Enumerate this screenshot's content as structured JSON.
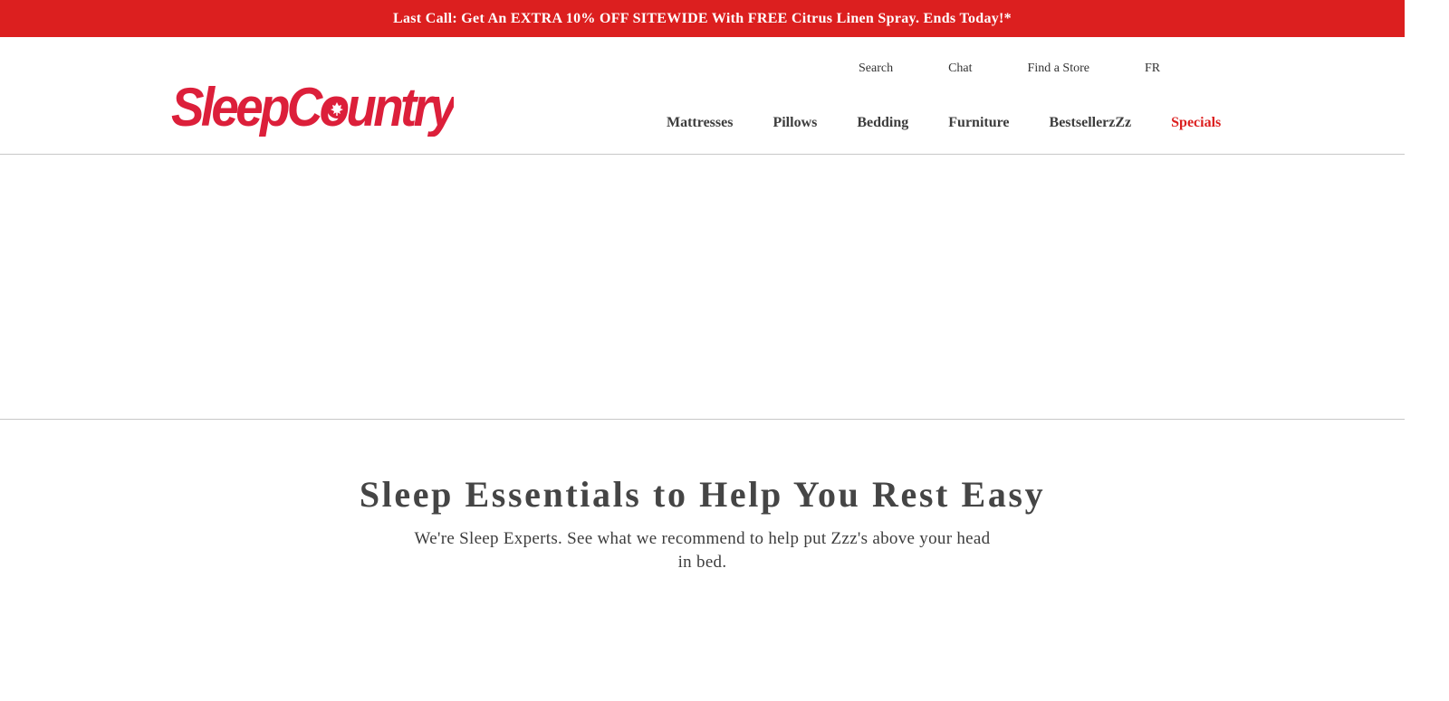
{
  "promo": {
    "text": "Last Call: Get An EXTRA 10% OFF SITEWIDE With FREE Citrus Linen Spray. Ends Today!*"
  },
  "brand": {
    "logo_text": "SleepCountry",
    "logo_icon": "maple-leaf-icon",
    "color": "#dc1f1f"
  },
  "utility_nav": {
    "items": [
      {
        "label": "Search"
      },
      {
        "label": "Chat"
      },
      {
        "label": "Find a Store"
      },
      {
        "label": "FR"
      }
    ]
  },
  "main_nav": {
    "items": [
      {
        "label": "Mattresses"
      },
      {
        "label": "Pillows"
      },
      {
        "label": "Bedding"
      },
      {
        "label": "Furniture"
      },
      {
        "label": "BestsellerzZz"
      },
      {
        "label": "Specials"
      }
    ],
    "special_color": "#dc1f1f"
  },
  "intro": {
    "heading": "Sleep Essentials to Help You Rest Easy",
    "subheading": "We're Sleep Experts. See what we recommend to help put Zzz's above your head in bed."
  }
}
